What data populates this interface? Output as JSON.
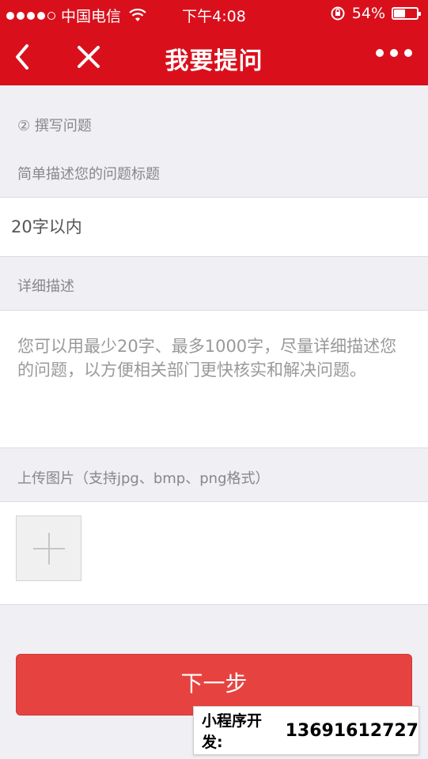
{
  "status_bar": {
    "carrier": "中国电信",
    "time": "下午4:08",
    "battery": "54%",
    "battery_level": 0.54
  },
  "nav": {
    "title": "我要提问"
  },
  "form": {
    "step_label": "② 撰写问题",
    "title_label": "简单描述您的问题标题",
    "title_placeholder": "20字以内",
    "detail_label": "详细描述",
    "detail_placeholder": "您可以用最少20字、最多1000字，尽量详细描述您的问题，以方便相关部门更快核实和解决问题。",
    "upload_label": "上传图片（支持jpg、bmp、png格式）",
    "next_label": "下一步"
  },
  "promo": {
    "label": "小程序开发:",
    "phone": "13691612727"
  },
  "colors": {
    "brand_red": "#d9101c",
    "button_red": "#e64340"
  }
}
